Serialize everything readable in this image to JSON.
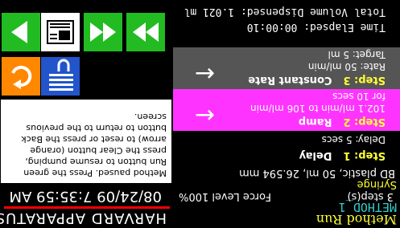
{
  "screen": {
    "title": "Method Run",
    "method_name": "METHOD_1",
    "steps_count": "3 step(s)",
    "force_level": "Force Level 100%",
    "syringe_label": "Syringe",
    "syringe_desc": "BD plastic, 50 ml, 26.594 mm",
    "time_elapsed": "Time Elapsed: 00:00:10",
    "total_volume": "Total Volume Dispensed: 1.021 ml"
  },
  "steps": [
    {
      "number": "Step: 1",
      "type": "Delay",
      "line1": "Delay: 5 secs",
      "line2": ""
    },
    {
      "number": "Step: 2",
      "type": "Ramp",
      "line1": "102.1 ml/min to 106 ml/min",
      "line2": "for 10 secs"
    },
    {
      "number": "Step: 3",
      "type": "Constant Rate",
      "line1": "Rate: 50 ml/min",
      "line2": "Target: 5 ml"
    }
  ],
  "panel": {
    "brand": "HARVARD APPARATUS",
    "datetime": "08/24/09 7:35:59 AM",
    "message": "Method paused. Press the green Run button to resume pumping, press the Clear button (orange arrow) to reset or press the Back button to return to the previous screen."
  },
  "buttons": {
    "reset": {
      "icon": "clear-reset-icon",
      "color": "#ff8800"
    },
    "stop": {
      "icon": "stop-method-icon",
      "color": "#2255cc"
    },
    "run": {
      "icon": "run-play-icon",
      "color": "#22bb22"
    },
    "method": {
      "icon": "method-screen-icon",
      "color": "#ffffff"
    },
    "fast_forward": {
      "icon": "fast-forward-icon",
      "color": "#22bb22"
    },
    "fast_reverse": {
      "icon": "fast-reverse-icon",
      "color": "#22bb22"
    }
  },
  "colors": {
    "highlight": "#ff33ff",
    "step_gray": "#555555",
    "accent_red": "#ff0000",
    "step_label": "#ffff33"
  }
}
